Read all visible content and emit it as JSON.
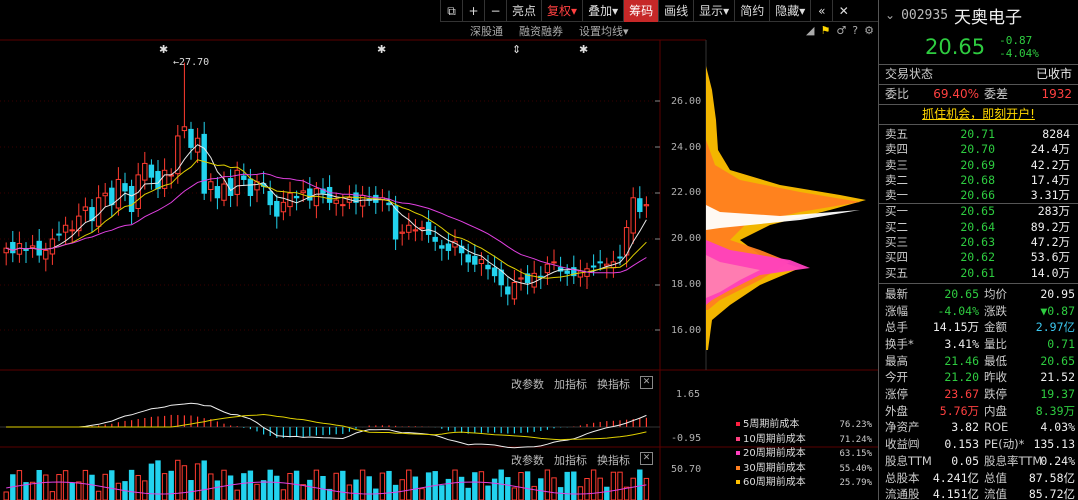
{
  "toolbar": {
    "items": [
      "亮点",
      "复权",
      "叠加",
      "筹码",
      "画线",
      "显示",
      "简约",
      "隐藏"
    ],
    "active": "筹码"
  },
  "subbar": {
    "items": [
      "深股通",
      "融资融券",
      "设置均线"
    ]
  },
  "chart": {
    "peak_label": "27.70",
    "price_axis": [
      "26.00",
      "24.00",
      "22.00",
      "20.00",
      "18.00",
      "16.00"
    ],
    "ind1_axis": [
      "1.65",
      "-0.95"
    ],
    "ind2_axis": [
      "50.70"
    ],
    "ind_buttons": [
      "改参数",
      "加指标",
      "换指标"
    ],
    "colors": {
      "up": "#ff3b30",
      "down": "#22d3ee",
      "ma5": "#e8e8e8",
      "ma10": "#e0d000",
      "ma20": "#e040e0"
    }
  },
  "chip_legend": [
    {
      "name": "5周期前成本",
      "pct": "76.23%",
      "color": "#ff2040"
    },
    {
      "name": "10周期前成本",
      "pct": "71.24%",
      "color": "#ff4080"
    },
    {
      "name": "20周期前成本",
      "pct": "63.15%",
      "color": "#ff40c0"
    },
    {
      "name": "30周期前成本",
      "pct": "55.40%",
      "color": "#ff8020"
    },
    {
      "name": "60周期前成本",
      "pct": "25.79%",
      "color": "#ffc000"
    }
  ],
  "quote": {
    "code": "002935",
    "name": "天奥电子",
    "price": "20.65",
    "change": "-0.87",
    "change_pct": "-4.04%",
    "status_label": "交易状态",
    "status": "已收市",
    "wb_label": "委比",
    "wb": "69.40%",
    "wc_label": "委差",
    "wc": "1932",
    "promo": "抓住机会，即刻开户!",
    "asks": [
      {
        "label": "卖五",
        "price": "20.71",
        "vol": "8284"
      },
      {
        "label": "卖四",
        "price": "20.70",
        "vol": "24.4万"
      },
      {
        "label": "卖三",
        "price": "20.69",
        "vol": "42.2万"
      },
      {
        "label": "卖二",
        "price": "20.68",
        "vol": "17.4万"
      },
      {
        "label": "卖一",
        "price": "20.66",
        "vol": "3.31万"
      }
    ],
    "bids": [
      {
        "label": "买一",
        "price": "20.65",
        "vol": "283万"
      },
      {
        "label": "买二",
        "price": "20.64",
        "vol": "89.2万"
      },
      {
        "label": "买三",
        "price": "20.63",
        "vol": "47.2万"
      },
      {
        "label": "买四",
        "price": "20.62",
        "vol": "53.6万"
      },
      {
        "label": "买五",
        "price": "20.61",
        "vol": "14.0万"
      }
    ],
    "stats": [
      {
        "l1": "最新",
        "v1": "20.65",
        "c1": "green",
        "l2": "均价",
        "v2": "20.95",
        "c2": "white"
      },
      {
        "l1": "涨幅",
        "v1": "-4.04%",
        "c1": "green",
        "l2": "涨跌",
        "v2": "▼0.87",
        "c2": "green"
      },
      {
        "l1": "总手",
        "v1": "14.15万",
        "c1": "white",
        "l2": "金额",
        "v2": "2.97亿",
        "c2": "cyanc"
      },
      {
        "l1": "换手*",
        "v1": "3.41%",
        "c1": "white",
        "l2": "量比",
        "v2": "0.71",
        "c2": "green"
      },
      {
        "l1": "最高",
        "v1": "21.46",
        "c1": "green",
        "l2": "最低",
        "v2": "20.65",
        "c2": "green"
      },
      {
        "l1": "今开",
        "v1": "21.20",
        "c1": "green",
        "l2": "昨收",
        "v2": "21.52",
        "c2": "white"
      },
      {
        "l1": "涨停",
        "v1": "23.67",
        "c1": "redc",
        "l2": "跌停",
        "v2": "19.37",
        "c2": "green"
      },
      {
        "l1": "外盘",
        "v1": "5.76万",
        "c1": "redc",
        "l2": "内盘",
        "v2": "8.39万",
        "c2": "green"
      },
      {
        "l1": "净资产",
        "v1": "3.82",
        "c1": "white",
        "l2": "ROE",
        "v2": "4.03%",
        "c2": "white"
      },
      {
        "l1": "收益㈣",
        "v1": "0.153",
        "c1": "white",
        "l2": "PE(动)*",
        "v2": "135.13",
        "c2": "white"
      },
      {
        "l1": "股息TTM",
        "v1": "0.05",
        "c1": "white",
        "l2": "股息率TTM",
        "v2": "0.24%",
        "c2": "white"
      },
      {
        "l1": "总股本",
        "v1": "4.241亿",
        "c1": "white",
        "l2": "总值",
        "v2": "87.58亿",
        "c2": "white"
      },
      {
        "l1": "流通股",
        "v1": "4.151亿",
        "c1": "white",
        "l2": "流值",
        "v2": "85.72亿",
        "c2": "white"
      }
    ]
  }
}
